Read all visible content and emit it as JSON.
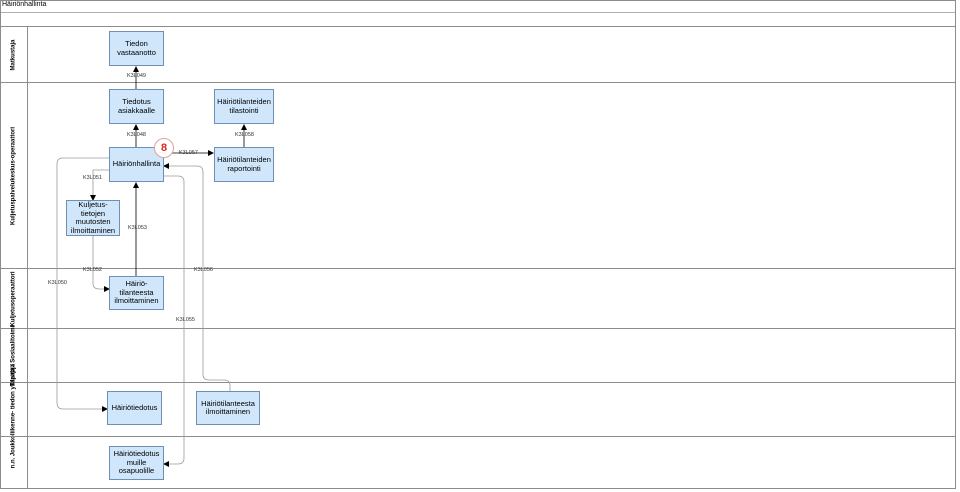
{
  "title": "Häiriönhallinta",
  "lanes": [
    {
      "label": "Matkustaja"
    },
    {
      "label": "Kuljetuspalvelukeskus-operaattori"
    },
    {
      "label": "Kuljetusoperaattori"
    },
    {
      "label": "Tilaaja /\nSosiaalitoimi"
    },
    {
      "label": "Joukkoliikenne-\ntiedon ylläpitäjä"
    },
    {
      "label": "n.n."
    }
  ],
  "boxes": {
    "tiedon_vastaanotto": "Tiedon\nvastaanotto",
    "tiedotus_asiakkaalle": "Tiedotus\nasiakkaalle",
    "tilastointi": "Häiriötilanteiden\ntilastointi",
    "hairionhallinta": "Häiriönhallinta",
    "raportointi": "Häiriötilanteiden\nraportointi",
    "kuljetustietojen": "Kuljetus-\ntietojen\nmuutosten\nilmoittaminen",
    "tilanteesta_ilmoittaminen": "Häiriö-\ntilanteesta\nilmoittaminen",
    "hairiotiedotus": "Häiriötiedotus",
    "hairiotilanteesta_ilmoittaminen": "Häiriötilanteesta\nilmoittaminen",
    "tiedotus_muille": "Häiriötiedotus\nmuille\nosapuolille"
  },
  "flows": {
    "k049": "K3L049",
    "k048": "K3L048",
    "k058": "K3L058",
    "k057": "K3L057",
    "k051": "K3L051",
    "k053": "K3L053",
    "k052": "K3L052",
    "k056": "K3L056",
    "k050": "K3L050",
    "k055": "K3L055"
  },
  "badge": "8",
  "colors": {
    "box_fill": "#cfe6fb",
    "box_border": "#6f8fb5",
    "badge": "#e0261b"
  }
}
